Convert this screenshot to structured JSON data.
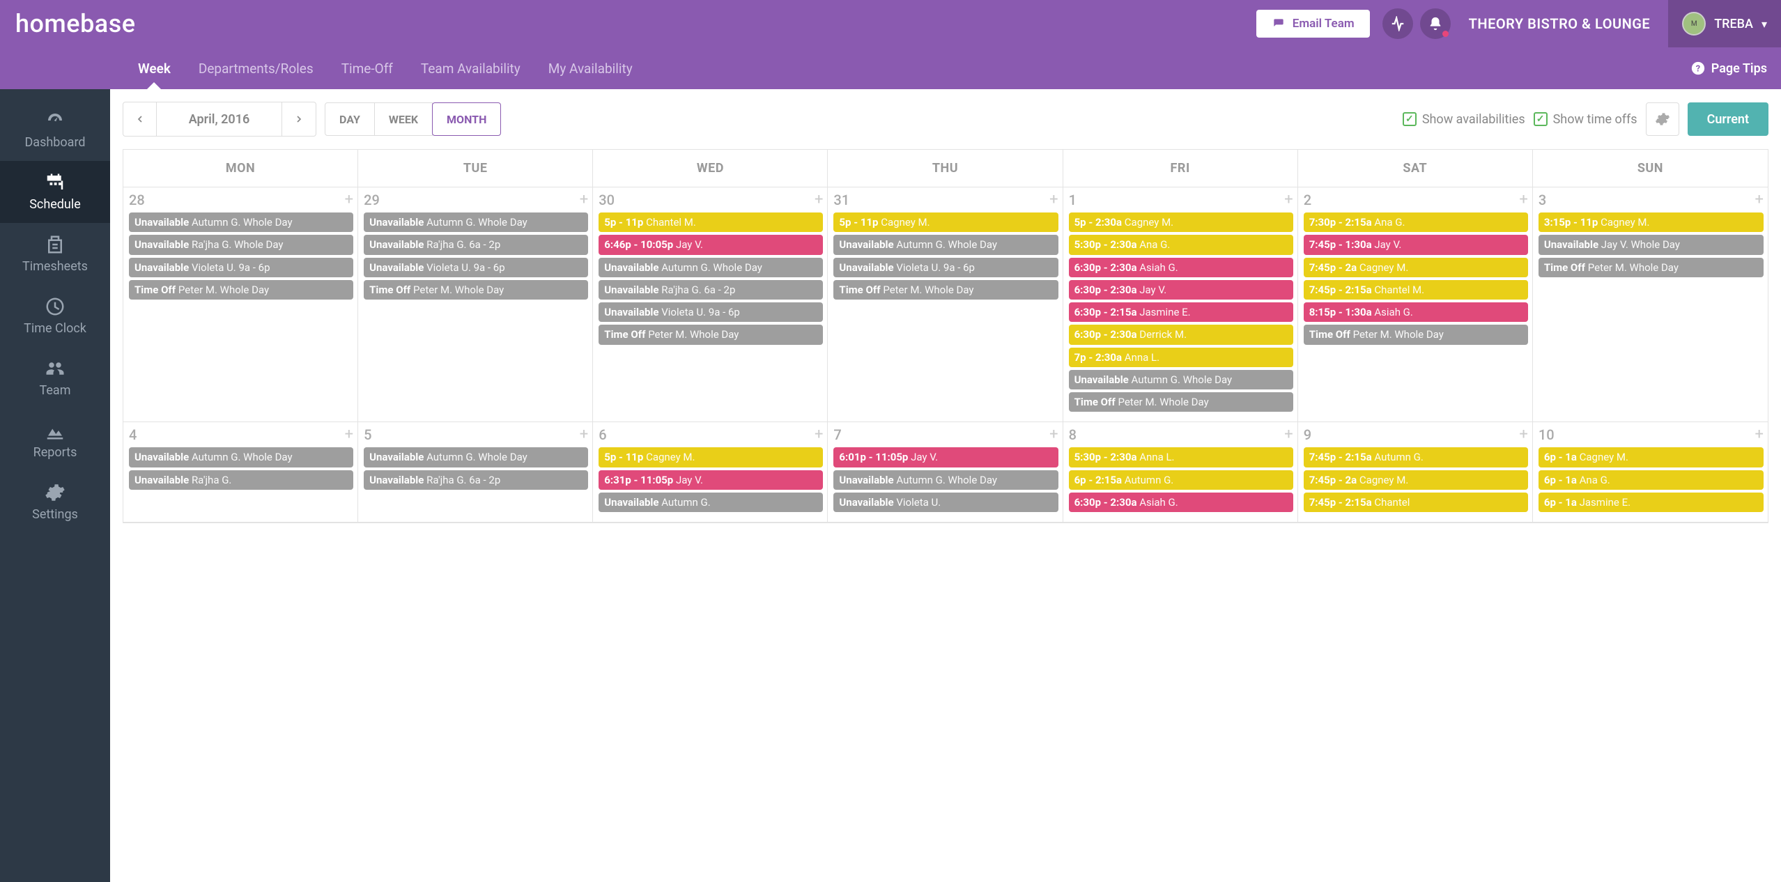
{
  "brand": "homebase",
  "header": {
    "email_team": "Email Team",
    "company": "THEORY BISTRO & LOUNGE",
    "user": "TREBA"
  },
  "subnav": {
    "items": [
      "Week",
      "Departments/Roles",
      "Time-Off",
      "Team Availability",
      "My Availability"
    ],
    "active": "Week",
    "page_tips": "Page Tips"
  },
  "sidebar": {
    "items": [
      "Dashboard",
      "Schedule",
      "Timesheets",
      "Time Clock",
      "Team",
      "Reports",
      "Settings"
    ],
    "active": "Schedule"
  },
  "toolbar": {
    "month": "April, 2016",
    "views": [
      "DAY",
      "WEEK",
      "MONTH"
    ],
    "active_view": "MONTH",
    "show_avail": "Show availabilities",
    "show_timeoff": "Show time offs",
    "current": "Current"
  },
  "calendar": {
    "dow": [
      "MON",
      "TUE",
      "WED",
      "THU",
      "FRI",
      "SAT",
      "SUN"
    ],
    "days": [
      {
        "num": "28",
        "events": [
          {
            "c": "gray",
            "b": "Unavailable",
            "l": "Autumn G. Whole Day"
          },
          {
            "c": "gray",
            "b": "Unavailable",
            "l": "Ra'jha G. Whole Day"
          },
          {
            "c": "gray",
            "b": "Unavailable",
            "l": "Violeta U. 9a - 6p"
          },
          {
            "c": "gray",
            "b": "Time Off",
            "l": "Peter M. Whole Day"
          }
        ]
      },
      {
        "num": "29",
        "events": [
          {
            "c": "gray",
            "b": "Unavailable",
            "l": "Autumn G. Whole Day"
          },
          {
            "c": "gray",
            "b": "Unavailable",
            "l": "Ra'jha G. 6a - 2p"
          },
          {
            "c": "gray",
            "b": "Unavailable",
            "l": "Violeta U. 9a - 6p"
          },
          {
            "c": "gray",
            "b": "Time Off",
            "l": "Peter M. Whole Day"
          }
        ]
      },
      {
        "num": "30",
        "events": [
          {
            "c": "yellow",
            "b": "5p - 11p",
            "l": "Chantel M."
          },
          {
            "c": "pink",
            "b": "6:46p - 10:05p",
            "l": "Jay V."
          },
          {
            "c": "gray",
            "b": "Unavailable",
            "l": "Autumn G. Whole Day"
          },
          {
            "c": "gray",
            "b": "Unavailable",
            "l": "Ra'jha G. 6a - 2p"
          },
          {
            "c": "gray",
            "b": "Unavailable",
            "l": "Violeta U. 9a - 6p"
          },
          {
            "c": "gray",
            "b": "Time Off",
            "l": "Peter M. Whole Day"
          }
        ]
      },
      {
        "num": "31",
        "events": [
          {
            "c": "yellow",
            "b": "5p - 11p",
            "l": "Cagney M."
          },
          {
            "c": "gray",
            "b": "Unavailable",
            "l": "Autumn G. Whole Day"
          },
          {
            "c": "gray",
            "b": "Unavailable",
            "l": "Violeta U. 9a - 6p"
          },
          {
            "c": "gray",
            "b": "Time Off",
            "l": "Peter M. Whole Day"
          }
        ]
      },
      {
        "num": "1",
        "events": [
          {
            "c": "yellow",
            "b": "5p - 2:30a",
            "l": "Cagney M."
          },
          {
            "c": "yellow",
            "b": "5:30p - 2:30a",
            "l": "Ana G."
          },
          {
            "c": "pink",
            "b": "6:30p - 2:30a",
            "l": "Asiah G."
          },
          {
            "c": "pink",
            "b": "6:30p - 2:30a",
            "l": "Jay V."
          },
          {
            "c": "pink",
            "b": "6:30p - 2:15a",
            "l": "Jasmine E."
          },
          {
            "c": "yellow",
            "b": "6:30p - 2:30a",
            "l": "Derrick M."
          },
          {
            "c": "yellow",
            "b": "7p - 2:30a",
            "l": "Anna L."
          },
          {
            "c": "gray",
            "b": "Unavailable",
            "l": "Autumn G. Whole Day"
          },
          {
            "c": "gray",
            "b": "Time Off",
            "l": "Peter M. Whole Day"
          }
        ]
      },
      {
        "num": "2",
        "events": [
          {
            "c": "yellow",
            "b": "7:30p - 2:15a",
            "l": "Ana G."
          },
          {
            "c": "pink",
            "b": "7:45p - 1:30a",
            "l": "Jay V."
          },
          {
            "c": "yellow",
            "b": "7:45p - 2a",
            "l": "Cagney M."
          },
          {
            "c": "yellow",
            "b": "7:45p - 2:15a",
            "l": "Chantel M."
          },
          {
            "c": "pink",
            "b": "8:15p - 1:30a",
            "l": "Asiah G."
          },
          {
            "c": "gray",
            "b": "Time Off",
            "l": "Peter M. Whole Day"
          }
        ]
      },
      {
        "num": "3",
        "events": [
          {
            "c": "yellow",
            "b": "3:15p - 11p",
            "l": "Cagney M."
          },
          {
            "c": "gray",
            "b": "Unavailable",
            "l": "Jay V. Whole Day"
          },
          {
            "c": "gray",
            "b": "Time Off",
            "l": "Peter M. Whole Day"
          }
        ]
      },
      {
        "num": "4",
        "events": [
          {
            "c": "gray",
            "b": "Unavailable",
            "l": "Autumn G. Whole Day"
          },
          {
            "c": "gray",
            "b": "Unavailable",
            "l": "Ra'jha G."
          }
        ]
      },
      {
        "num": "5",
        "events": [
          {
            "c": "gray",
            "b": "Unavailable",
            "l": "Autumn G. Whole Day"
          },
          {
            "c": "gray",
            "b": "Unavailable",
            "l": "Ra'jha G. 6a - 2p"
          }
        ]
      },
      {
        "num": "6",
        "events": [
          {
            "c": "yellow",
            "b": "5p - 11p",
            "l": "Cagney M."
          },
          {
            "c": "pink",
            "b": "6:31p - 11:05p",
            "l": "Jay V."
          },
          {
            "c": "gray",
            "b": "Unavailable",
            "l": "Autumn G."
          }
        ]
      },
      {
        "num": "7",
        "events": [
          {
            "c": "pink",
            "b": "6:01p - 11:05p",
            "l": "Jay V."
          },
          {
            "c": "gray",
            "b": "Unavailable",
            "l": "Autumn G. Whole Day"
          },
          {
            "c": "gray",
            "b": "Unavailable",
            "l": "Violeta U."
          }
        ]
      },
      {
        "num": "8",
        "events": [
          {
            "c": "yellow",
            "b": "5:30p - 2:30a",
            "l": "Anna L."
          },
          {
            "c": "yellow",
            "b": "6p - 2:15a",
            "l": "Autumn G."
          },
          {
            "c": "pink",
            "b": "6:30p - 2:30a",
            "l": "Asiah G."
          }
        ]
      },
      {
        "num": "9",
        "events": [
          {
            "c": "yellow",
            "b": "7:45p - 2:15a",
            "l": "Autumn G."
          },
          {
            "c": "yellow",
            "b": "7:45p - 2a",
            "l": "Cagney M."
          },
          {
            "c": "yellow",
            "b": "7:45p - 2:15a",
            "l": "Chantel"
          }
        ]
      },
      {
        "num": "10",
        "events": [
          {
            "c": "yellow",
            "b": "6p - 1a",
            "l": "Cagney M."
          },
          {
            "c": "yellow",
            "b": "6p - 1a",
            "l": "Ana G."
          },
          {
            "c": "yellow",
            "b": "6p - 1a",
            "l": "Jasmine E."
          }
        ]
      }
    ]
  }
}
